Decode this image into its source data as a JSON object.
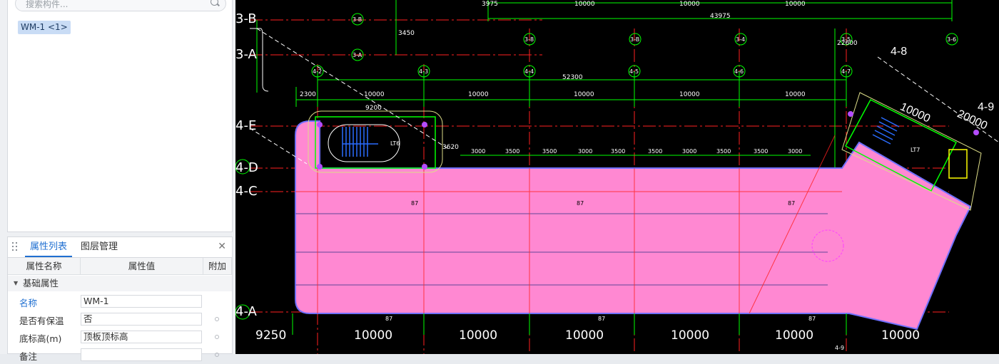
{
  "sidebar": {
    "search_placeholder": "搜索构件...",
    "selected_item": "WM-1 <1>"
  },
  "properties": {
    "tabs": [
      {
        "label": "属性列表",
        "active": true
      },
      {
        "label": "图层管理",
        "active": false
      }
    ],
    "close_glyph": "✕",
    "columns": {
      "name": "属性名称",
      "value": "属性值",
      "extra": "附加"
    },
    "group": "基础属性",
    "rows": [
      {
        "name": "名称",
        "value": "WM-1"
      },
      {
        "name": "是否有保温",
        "value": "否"
      },
      {
        "name": "底标高(m)",
        "value": "顶板顶标高"
      },
      {
        "name": "备注",
        "value": ""
      }
    ]
  },
  "cad": {
    "axis_left": [
      "3-B",
      "3-A",
      "4-E",
      "4-D",
      "4-C",
      "4-A"
    ],
    "axis_bottom": [
      "9250",
      "10000",
      "10000",
      "10000",
      "10000",
      "10000",
      "10000"
    ],
    "top_dims": [
      "3975",
      "10000",
      "10000",
      "10000",
      "43975",
      "3450",
      "22600",
      "52300",
      "2300",
      "10000",
      "10000",
      "10000",
      "10000",
      "10000",
      "9200",
      "3620"
    ],
    "sub_dims": [
      "3000",
      "3500",
      "3500",
      "3000",
      "3500",
      "3500",
      "3000",
      "3500",
      "3500",
      "3000"
    ],
    "bubbles_top": [
      "3-B",
      "3-A",
      "3-8",
      "3-B",
      "3-4",
      "3-5",
      "3-6",
      "4-2",
      "4-3",
      "4-4",
      "4-5",
      "4-6",
      "4-7"
    ],
    "right_labels": [
      "4-8",
      "4-9",
      "10000",
      "20000",
      "LT7"
    ],
    "stair_label": "LT6",
    "slab_marks": [
      "87",
      "87",
      "87",
      "87",
      "87",
      "87"
    ],
    "bottom_axis_tag": "4-9",
    "colors": {
      "slab": "#ff88d2",
      "grid_green": "#00ff00",
      "axis_red": "#ff0000",
      "background": "#000000",
      "accent": "#1f6fd1"
    }
  }
}
